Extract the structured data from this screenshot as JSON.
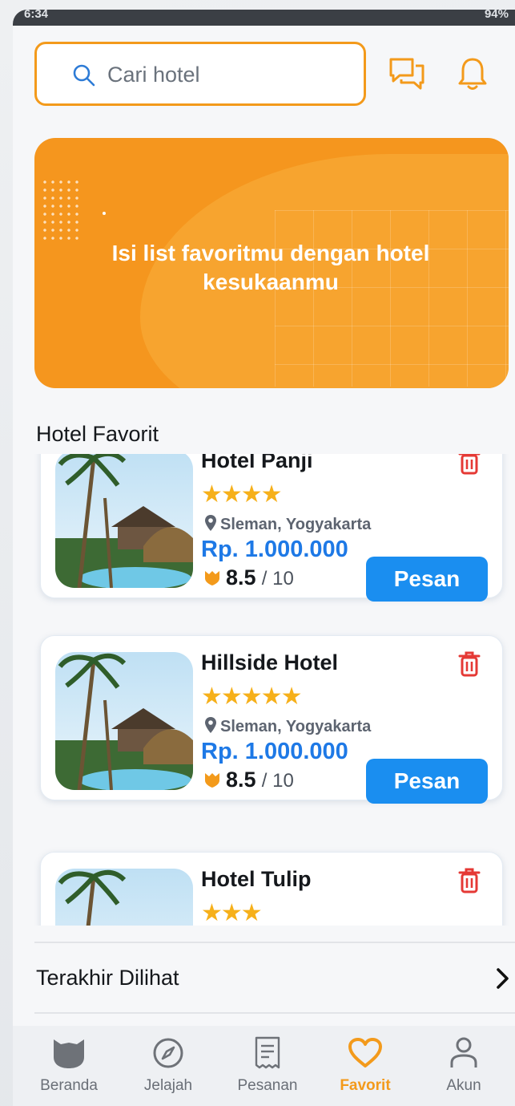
{
  "status_bar": {
    "time": "6:34",
    "battery": "94%"
  },
  "search": {
    "placeholder": "Cari hotel"
  },
  "icons": {
    "search": "search-icon",
    "chat": "chat-icon",
    "notification": "bell-icon",
    "delete": "trash-icon",
    "location": "location-pin-icon",
    "rating": "shield-badge-icon",
    "arrow": "chevron-right-icon"
  },
  "banner": {
    "message": "Isi list favoritmu dengan hotel kesukaanmu"
  },
  "favorites": {
    "title": "Hotel Favorit",
    "hotels": [
      {
        "name": "Hotel Panji",
        "stars": "★★★★",
        "star_count": 4,
        "location": "Sleman, Yogyakarta",
        "price": "Rp. 1.000.000",
        "rating": "8.5",
        "rating_max": "/ 10",
        "book_label": "Pesan"
      },
      {
        "name": "Hillside Hotel",
        "stars": "★★★★★",
        "star_count": 5,
        "location": "Sleman, Yogyakarta",
        "price": "Rp. 1.000.000",
        "rating": "8.5",
        "rating_max": "/ 10",
        "book_label": "Pesan"
      },
      {
        "name": "Hotel Tulip",
        "stars": "★★★",
        "star_count": 3
      }
    ]
  },
  "recently_viewed": {
    "label": "Terakhir Dilihat"
  },
  "bottom_nav": {
    "items": [
      {
        "label": "Beranda",
        "icon": "home-icon"
      },
      {
        "label": "Jelajah",
        "icon": "compass-icon"
      },
      {
        "label": "Pesanan",
        "icon": "receipt-icon"
      },
      {
        "label": "Favorit",
        "icon": "heart-icon",
        "active": true
      },
      {
        "label": "Akun",
        "icon": "user-icon"
      }
    ]
  },
  "colors": {
    "primary_orange": "#f39a1b",
    "button_blue": "#1a8ef0",
    "price_blue": "#1e79e6",
    "star_yellow": "#f6b01a",
    "delete_red": "#e53935"
  }
}
